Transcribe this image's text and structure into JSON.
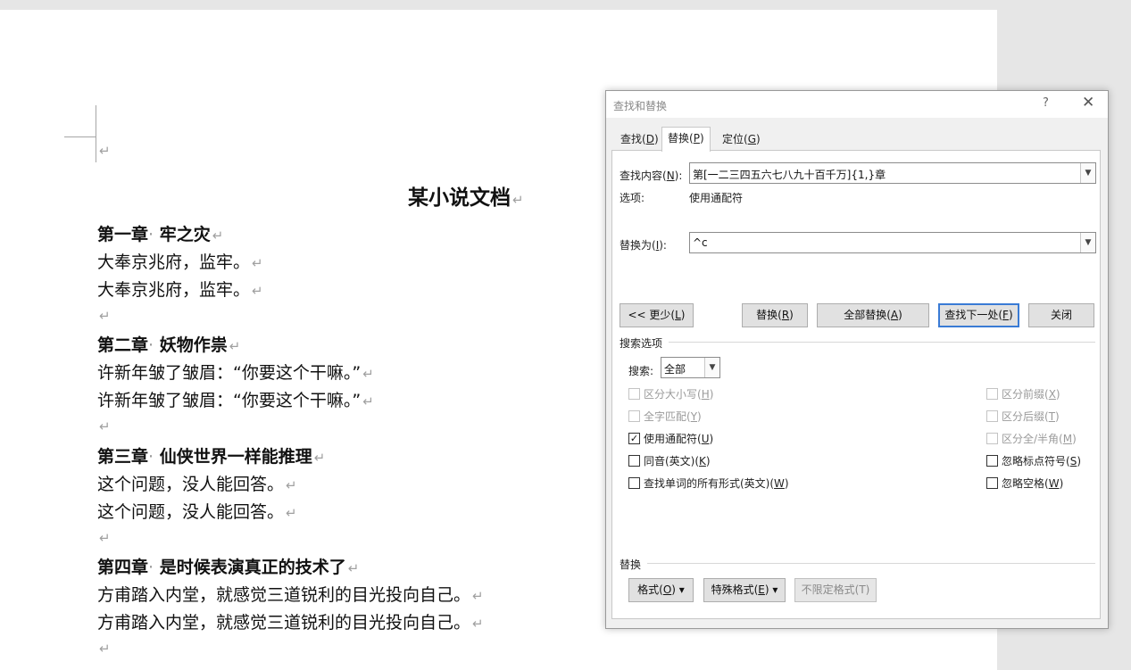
{
  "document": {
    "title": "某小说文档",
    "paragraph_mark": "↵",
    "chapter_dot": "·",
    "chapters": [
      {
        "label": "第一章",
        "name": "牢之灾",
        "lines": [
          "大奉京兆府，监牢。",
          "大奉京兆府，监牢。"
        ]
      },
      {
        "label": "第二章",
        "name": "妖物作祟",
        "lines": [
          "许新年皱了皱眉：“你要这个干嘛。”",
          "许新年皱了皱眉：“你要这个干嘛。”"
        ]
      },
      {
        "label": "第三章",
        "name": "仙侠世界一样能推理",
        "lines": [
          "这个问题，没人能回答。",
          "这个问题，没人能回答。"
        ]
      },
      {
        "label": "第四章",
        "name": "是时候表演真正的技术了",
        "lines": [
          "方甫踏入内堂，就感觉三道锐利的目光投向自己。",
          "方甫踏入内堂，就感觉三道锐利的目光投向自己。"
        ]
      }
    ]
  },
  "dialog": {
    "title": "查找和替换",
    "help": "?",
    "close": "✕",
    "tabs": [
      "查找(D)",
      "替换(P)",
      "定位(G)"
    ],
    "active_tab": 1,
    "find_label": "查找内容(N):",
    "find_value": "第[一二三四五六七八九十百千万]{1,}章",
    "options_label": "选项:",
    "options_value": "使用通配符",
    "replace_label": "替换为(I):",
    "replace_value": "^c",
    "buttons": {
      "less": "<< 更少(L)",
      "replace": "替换(R)",
      "replace_all": "全部替换(A)",
      "find_next": "查找下一处(F)",
      "close": "关闭"
    },
    "search_options_title": "搜索选项",
    "search_label": "搜索:",
    "search_value": "全部",
    "checkboxes_left": [
      {
        "label": "区分大小写(H)",
        "checked": false,
        "enabled": false
      },
      {
        "label": "全字匹配(Y)",
        "checked": false,
        "enabled": false
      },
      {
        "label": "使用通配符(U)",
        "checked": true,
        "enabled": true
      },
      {
        "label": "同音(英文)(K)",
        "checked": false,
        "enabled": true
      },
      {
        "label": "查找单词的所有形式(英文)(W)",
        "checked": false,
        "enabled": true
      }
    ],
    "checkboxes_right": [
      {
        "label": "区分前缀(X)",
        "checked": false,
        "enabled": false
      },
      {
        "label": "区分后缀(T)",
        "checked": false,
        "enabled": false
      },
      {
        "label": "区分全/半角(M)",
        "checked": false,
        "enabled": false
      },
      {
        "label": "忽略标点符号(S)",
        "checked": false,
        "enabled": true
      },
      {
        "label": "忽略空格(W)",
        "checked": false,
        "enabled": true
      }
    ],
    "replace_section_title": "替换",
    "format_buttons": {
      "format": "格式(O)",
      "special": "特殊格式(E)",
      "no_format": "不限定格式(T)"
    },
    "check_mark": "✓",
    "dropdown_icon": "chevron-down-icon"
  }
}
